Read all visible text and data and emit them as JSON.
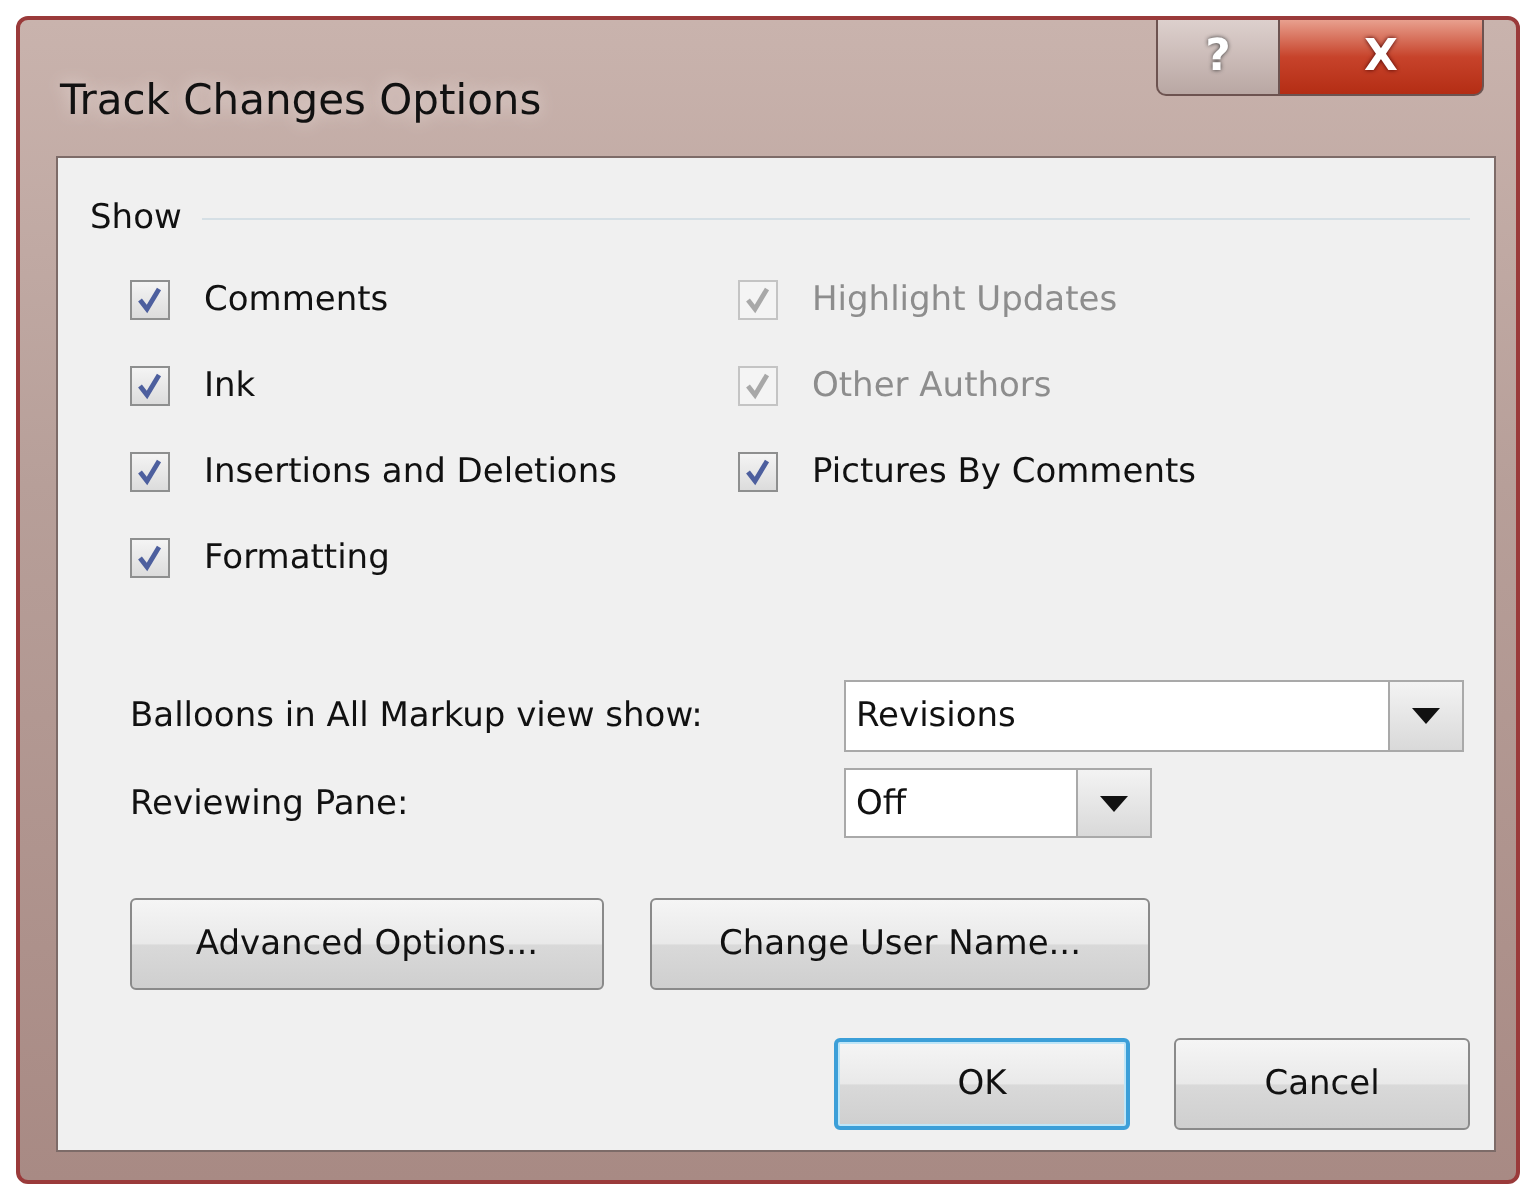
{
  "window": {
    "title": "Track Changes Options",
    "caption_buttons": [
      {
        "kind": "help",
        "label": "?"
      },
      {
        "kind": "close",
        "label": "X"
      }
    ]
  },
  "show": {
    "heading": "Show",
    "checkboxes": [
      {
        "label": "Comments",
        "checked": true,
        "disabled": false
      },
      {
        "label": "Highlight Updates",
        "checked": true,
        "disabled": true
      },
      {
        "label": "Ink",
        "checked": true,
        "disabled": false
      },
      {
        "label": "Other Authors",
        "checked": true,
        "disabled": true
      },
      {
        "label": "Insertions and Deletions",
        "checked": true,
        "disabled": false
      },
      {
        "label": "Pictures By Comments",
        "checked": true,
        "disabled": false
      },
      {
        "label": "Formatting",
        "checked": true,
        "disabled": false
      }
    ]
  },
  "dropdowns": [
    {
      "label": "Balloons in All Markup view show:",
      "value": "Revisions",
      "kind": "wide"
    },
    {
      "label": "Reviewing Pane:",
      "value": "Off",
      "kind": "narrow"
    }
  ],
  "buttons": [
    {
      "label": "Advanced Options...",
      "default": false
    },
    {
      "label": "Change User Name...",
      "default": false
    }
  ],
  "footer_buttons": [
    {
      "label": "OK",
      "default": true
    },
    {
      "label": "Cancel",
      "default": false
    }
  ]
}
